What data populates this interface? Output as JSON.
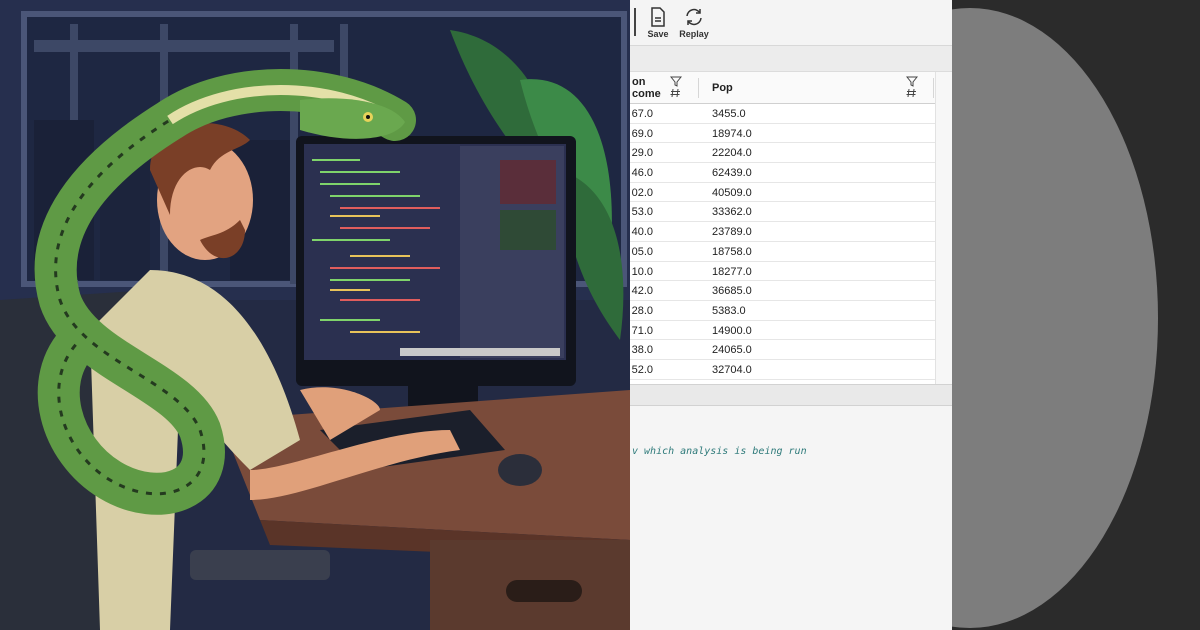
{
  "toolbar": {
    "save_label": "Save",
    "replay_label": "Replay",
    "save_icon": "document-icon",
    "replay_icon": "refresh-icon"
  },
  "table": {
    "columns": [
      {
        "label": "on\ncome",
        "key": "income"
      },
      {
        "label": "Pop",
        "key": "pop"
      }
    ],
    "rows": [
      {
        "income": "67.0",
        "pop": "3455.0"
      },
      {
        "income": "69.0",
        "pop": "18974.0"
      },
      {
        "income": "29.0",
        "pop": "22204.0"
      },
      {
        "income": "46.0",
        "pop": "62439.0"
      },
      {
        "income": "02.0",
        "pop": "40509.0"
      },
      {
        "income": "53.0",
        "pop": "33362.0"
      },
      {
        "income": "40.0",
        "pop": "23789.0"
      },
      {
        "income": "05.0",
        "pop": "18758.0"
      },
      {
        "income": "10.0",
        "pop": "18277.0"
      },
      {
        "income": "42.0",
        "pop": "36685.0"
      },
      {
        "income": "28.0",
        "pop": "5383.0"
      },
      {
        "income": "71.0",
        "pop": "14900.0"
      },
      {
        "income": "38.0",
        "pop": "24065.0"
      },
      {
        "income": "52.0",
        "pop": "32704.0"
      }
    ]
  },
  "console": {
    "line": "v which analysis is being run"
  },
  "colors": {
    "console_text": "#2e7a7a",
    "snake_green": "#6aa84f",
    "right_bg": "#2b2b2b",
    "disc": "#7d7d7d"
  }
}
